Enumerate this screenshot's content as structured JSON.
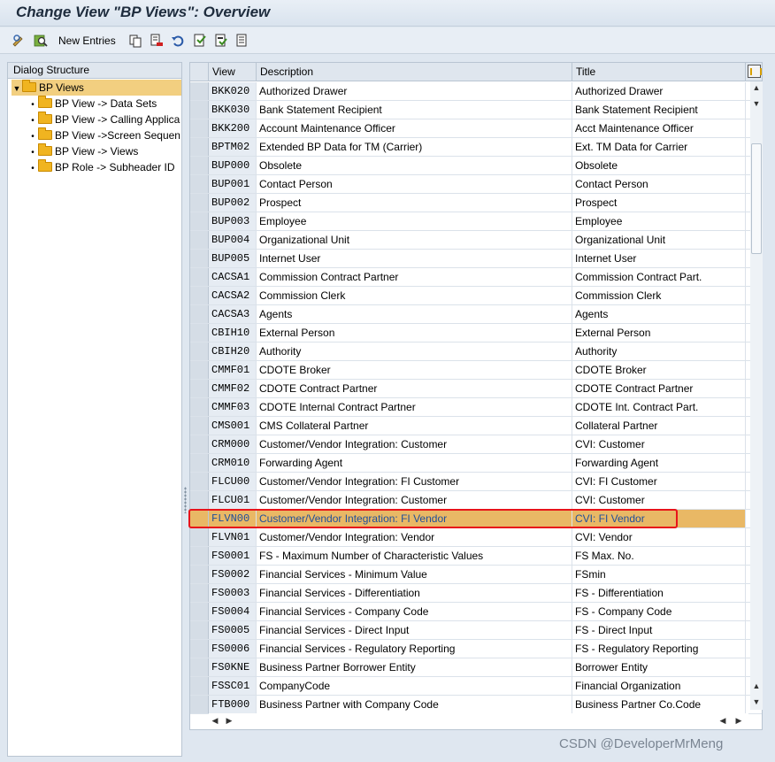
{
  "window": {
    "title": "Change View \"BP Views\": Overview"
  },
  "toolbar": {
    "new_entries_label": "New Entries",
    "icons": [
      "display-change-icon",
      "find-icon",
      "copy-icon",
      "delete-icon",
      "undo-icon",
      "select-all-icon",
      "select-block-icon",
      "deselect-all-icon"
    ]
  },
  "dialog_structure": {
    "header": "Dialog Structure",
    "items": [
      {
        "label": "BP Views",
        "level": 0,
        "expanded": true,
        "selected": true
      },
      {
        "label": "BP View -> Data Sets",
        "level": 1
      },
      {
        "label": "BP View -> Calling Applica",
        "level": 1
      },
      {
        "label": "BP View ->Screen Sequen",
        "level": 1
      },
      {
        "label": "BP View -> Views",
        "level": 1
      },
      {
        "label": "BP Role -> Subheader ID",
        "level": 1
      }
    ]
  },
  "table": {
    "columns": [
      "View",
      "Description",
      "Title"
    ],
    "rows": [
      [
        "BKK020",
        "Authorized Drawer",
        "Authorized Drawer"
      ],
      [
        "BKK030",
        "Bank Statement Recipient",
        "Bank Statement Recipient"
      ],
      [
        "BKK200",
        "Account Maintenance Officer",
        "Acct Maintenance Officer"
      ],
      [
        "BPTM02",
        "Extended BP Data for TM (Carrier)",
        "Ext. TM Data for Carrier"
      ],
      [
        "BUP000",
        "Obsolete",
        "Obsolete"
      ],
      [
        "BUP001",
        "Contact Person",
        "Contact Person"
      ],
      [
        "BUP002",
        "Prospect",
        "Prospect"
      ],
      [
        "BUP003",
        "Employee",
        "Employee"
      ],
      [
        "BUP004",
        "Organizational Unit",
        "Organizational Unit"
      ],
      [
        "BUP005",
        "Internet User",
        "Internet User"
      ],
      [
        "CACSA1",
        "Commission Contract Partner",
        "Commission Contract Part."
      ],
      [
        "CACSA2",
        "Commission Clerk",
        "Commission Clerk"
      ],
      [
        "CACSA3",
        "Agents",
        "Agents"
      ],
      [
        "CBIH10",
        "External Person",
        "External Person"
      ],
      [
        "CBIH20",
        "Authority",
        "Authority"
      ],
      [
        "CMMF01",
        "CDOTE Broker",
        "CDOTE Broker"
      ],
      [
        "CMMF02",
        "CDOTE Contract Partner",
        "CDOTE Contract Partner"
      ],
      [
        "CMMF03",
        "CDOTE Internal Contract Partner",
        "CDOTE Int. Contract Part."
      ],
      [
        "CMS001",
        "CMS Collateral Partner",
        "Collateral Partner"
      ],
      [
        "CRM000",
        "Customer/Vendor Integration: Customer",
        "CVI: Customer"
      ],
      [
        "CRM010",
        "Forwarding Agent",
        "Forwarding Agent"
      ],
      [
        "FLCU00",
        "Customer/Vendor Integration: FI Customer",
        "CVI: FI Customer"
      ],
      [
        "FLCU01",
        "Customer/Vendor Integration: Customer",
        "CVI: Customer"
      ],
      [
        "FLVN00",
        "Customer/Vendor Integration: FI Vendor",
        "CVI: FI Vendor"
      ],
      [
        "FLVN01",
        "Customer/Vendor Integration: Vendor",
        "CVI: Vendor"
      ],
      [
        "FS0001",
        "FS - Maximum Number of Characteristic Values",
        "FS Max. No."
      ],
      [
        "FS0002",
        "Financial Services - Minimum Value",
        "FSmin"
      ],
      [
        "FS0003",
        "Financial Services - Differentiation",
        "FS -  Differentiation"
      ],
      [
        "FS0004",
        "Financial Services - Company Code",
        "FS - Company Code"
      ],
      [
        "FS0005",
        "Financial Services - Direct Input",
        "FS - Direct Input"
      ],
      [
        "FS0006",
        "Financial Services - Regulatory Reporting",
        "FS - Regulatory Reporting"
      ],
      [
        "FS0KNE",
        "Business Partner Borrower Entity",
        "Borrower Entity"
      ],
      [
        "FSSC01",
        "CompanyCode",
        "Financial Organization"
      ],
      [
        "FTB000",
        "Business Partner with Company Code",
        "Business Partner Co.Code"
      ]
    ],
    "highlighted_row_index": 23
  },
  "watermark": "CSDN @DeveloperMrMeng"
}
